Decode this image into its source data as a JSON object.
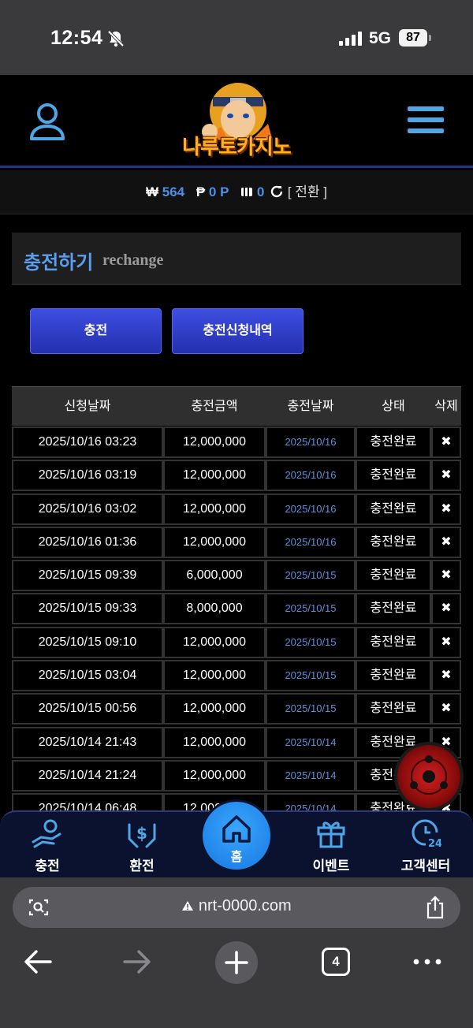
{
  "status_bar": {
    "time": "12:54",
    "network": "5G",
    "battery": "87"
  },
  "header": {
    "logo_text": "나루토카지노"
  },
  "balance": {
    "won_symbol": "₩",
    "won_value": "564",
    "point_symbol": "₱",
    "point_value": "0 P",
    "chip_value": "0",
    "switch_label": "[ 전환 ]"
  },
  "panel": {
    "title": "충전하기",
    "subtitle": "rechange"
  },
  "buttons": {
    "charge": "충전",
    "history": "충전신청내역"
  },
  "table": {
    "headers": [
      "신청날짜",
      "충전금액",
      "충전날짜",
      "상태",
      "삭제"
    ],
    "rows": [
      {
        "req": "2025/10/16 03:23",
        "amt": "12,000,000",
        "date": "2025/10/16",
        "status": "충전완료",
        "del": "✖"
      },
      {
        "req": "2025/10/16 03:19",
        "amt": "12,000,000",
        "date": "2025/10/16",
        "status": "충전완료",
        "del": "✖"
      },
      {
        "req": "2025/10/16 03:02",
        "amt": "12,000,000",
        "date": "2025/10/16",
        "status": "충전완료",
        "del": "✖"
      },
      {
        "req": "2025/10/16 01:36",
        "amt": "12,000,000",
        "date": "2025/10/16",
        "status": "충전완료",
        "del": "✖"
      },
      {
        "req": "2025/10/15 09:39",
        "amt": "6,000,000",
        "date": "2025/10/15",
        "status": "충전완료",
        "del": "✖"
      },
      {
        "req": "2025/10/15 09:33",
        "amt": "8,000,000",
        "date": "2025/10/15",
        "status": "충전완료",
        "del": "✖"
      },
      {
        "req": "2025/10/15 09:10",
        "amt": "12,000,000",
        "date": "2025/10/15",
        "status": "충전완료",
        "del": "✖"
      },
      {
        "req": "2025/10/15 03:04",
        "amt": "12,000,000",
        "date": "2025/10/15",
        "status": "충전완료",
        "del": "✖"
      },
      {
        "req": "2025/10/15 00:56",
        "amt": "12,000,000",
        "date": "2025/10/15",
        "status": "충전완료",
        "del": "✖"
      },
      {
        "req": "2025/10/14 21:43",
        "amt": "12,000,000",
        "date": "2025/10/14",
        "status": "충전완료",
        "del": "✖"
      },
      {
        "req": "2025/10/14 21:24",
        "amt": "12,000,000",
        "date": "2025/10/14",
        "status": "충전완료",
        "del": "✖"
      },
      {
        "req": "2025/10/14 06:48",
        "amt": "12,000,000",
        "date": "2025/10/14",
        "status": "충전완료",
        "del": "✖"
      }
    ]
  },
  "bottom_nav": {
    "items": [
      {
        "label": "충전",
        "icon": "hand-coin-icon"
      },
      {
        "label": "환전",
        "icon": "hands-dollar-icon"
      },
      {
        "label": "홈",
        "icon": "home-icon"
      },
      {
        "label": "이벤트",
        "icon": "gift-icon"
      },
      {
        "label": "고객센터",
        "icon": "support-24-icon"
      }
    ]
  },
  "browser": {
    "url": "nrt-0000.com",
    "tab_count": "4"
  },
  "colors": {
    "accent": "#4c8ee8",
    "button": "#2f3dc8",
    "nav_bg": "#0a1230"
  }
}
